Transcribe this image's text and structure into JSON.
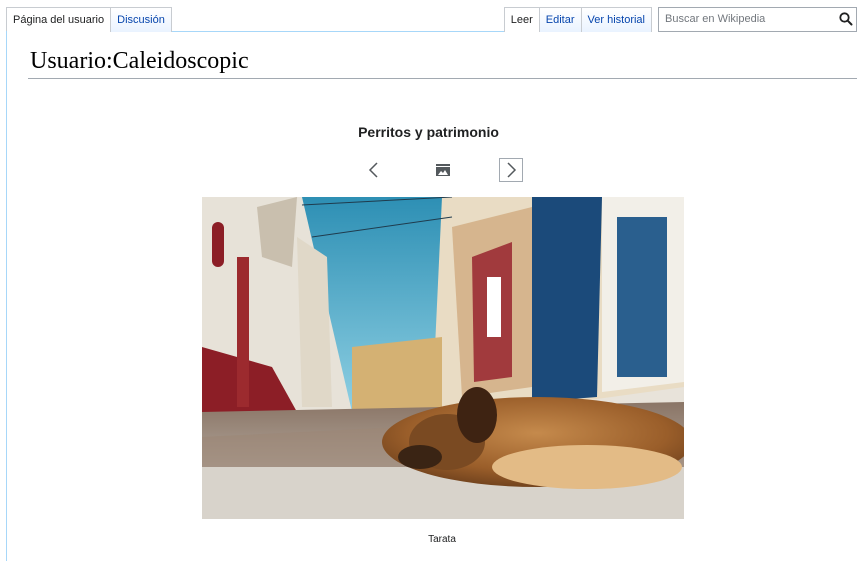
{
  "tabs": {
    "user_page": "Página del usuario",
    "talk": "Discusión",
    "read": "Leer",
    "edit": "Editar",
    "history": "Ver historial"
  },
  "search": {
    "placeholder": "Buscar en Wikipedia",
    "icon": "magnifier-icon"
  },
  "page": {
    "title": "Usuario:Caleidoscopic"
  },
  "slideshow": {
    "title": "Perritos y patrimonio",
    "prev_icon": "chevron-left-icon",
    "gallery_icon": "gallery-icon",
    "next_icon": "chevron-right-icon",
    "image_caption": "Tarata"
  },
  "colors": {
    "link": "#0645ad",
    "tab_border": "#a7d7f9",
    "rule": "#a2a9b1"
  }
}
